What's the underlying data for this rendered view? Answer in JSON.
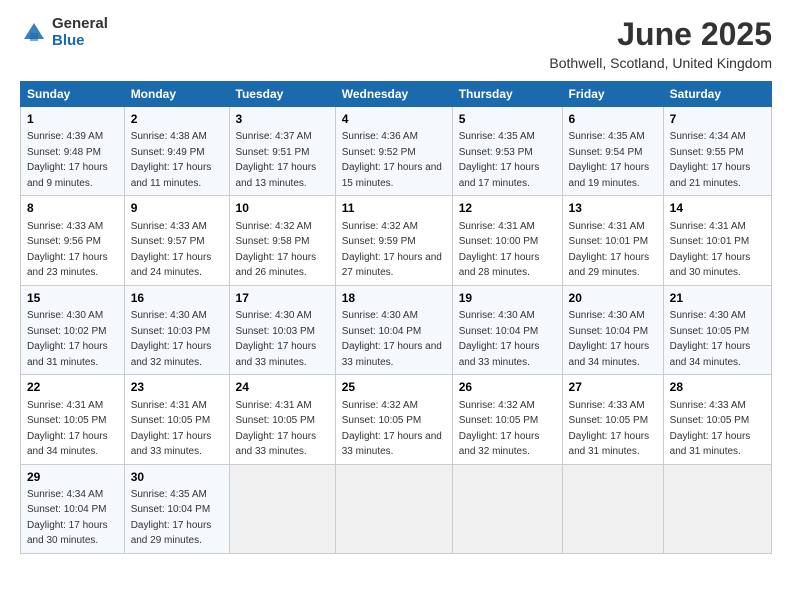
{
  "logo": {
    "general": "General",
    "blue": "Blue"
  },
  "title": "June 2025",
  "subtitle": "Bothwell, Scotland, United Kingdom",
  "headers": [
    "Sunday",
    "Monday",
    "Tuesday",
    "Wednesday",
    "Thursday",
    "Friday",
    "Saturday"
  ],
  "weeks": [
    [
      {
        "day": "1",
        "sunrise": "4:39 AM",
        "sunset": "9:48 PM",
        "daylight": "17 hours and 9 minutes."
      },
      {
        "day": "2",
        "sunrise": "4:38 AM",
        "sunset": "9:49 PM",
        "daylight": "17 hours and 11 minutes."
      },
      {
        "day": "3",
        "sunrise": "4:37 AM",
        "sunset": "9:51 PM",
        "daylight": "17 hours and 13 minutes."
      },
      {
        "day": "4",
        "sunrise": "4:36 AM",
        "sunset": "9:52 PM",
        "daylight": "17 hours and 15 minutes."
      },
      {
        "day": "5",
        "sunrise": "4:35 AM",
        "sunset": "9:53 PM",
        "daylight": "17 hours and 17 minutes."
      },
      {
        "day": "6",
        "sunrise": "4:35 AM",
        "sunset": "9:54 PM",
        "daylight": "17 hours and 19 minutes."
      },
      {
        "day": "7",
        "sunrise": "4:34 AM",
        "sunset": "9:55 PM",
        "daylight": "17 hours and 21 minutes."
      }
    ],
    [
      {
        "day": "8",
        "sunrise": "4:33 AM",
        "sunset": "9:56 PM",
        "daylight": "17 hours and 23 minutes."
      },
      {
        "day": "9",
        "sunrise": "4:33 AM",
        "sunset": "9:57 PM",
        "daylight": "17 hours and 24 minutes."
      },
      {
        "day": "10",
        "sunrise": "4:32 AM",
        "sunset": "9:58 PM",
        "daylight": "17 hours and 26 minutes."
      },
      {
        "day": "11",
        "sunrise": "4:32 AM",
        "sunset": "9:59 PM",
        "daylight": "17 hours and 27 minutes."
      },
      {
        "day": "12",
        "sunrise": "4:31 AM",
        "sunset": "10:00 PM",
        "daylight": "17 hours and 28 minutes."
      },
      {
        "day": "13",
        "sunrise": "4:31 AM",
        "sunset": "10:01 PM",
        "daylight": "17 hours and 29 minutes."
      },
      {
        "day": "14",
        "sunrise": "4:31 AM",
        "sunset": "10:01 PM",
        "daylight": "17 hours and 30 minutes."
      }
    ],
    [
      {
        "day": "15",
        "sunrise": "4:30 AM",
        "sunset": "10:02 PM",
        "daylight": "17 hours and 31 minutes."
      },
      {
        "day": "16",
        "sunrise": "4:30 AM",
        "sunset": "10:03 PM",
        "daylight": "17 hours and 32 minutes."
      },
      {
        "day": "17",
        "sunrise": "4:30 AM",
        "sunset": "10:03 PM",
        "daylight": "17 hours and 33 minutes."
      },
      {
        "day": "18",
        "sunrise": "4:30 AM",
        "sunset": "10:04 PM",
        "daylight": "17 hours and 33 minutes."
      },
      {
        "day": "19",
        "sunrise": "4:30 AM",
        "sunset": "10:04 PM",
        "daylight": "17 hours and 33 minutes."
      },
      {
        "day": "20",
        "sunrise": "4:30 AM",
        "sunset": "10:04 PM",
        "daylight": "17 hours and 34 minutes."
      },
      {
        "day": "21",
        "sunrise": "4:30 AM",
        "sunset": "10:05 PM",
        "daylight": "17 hours and 34 minutes."
      }
    ],
    [
      {
        "day": "22",
        "sunrise": "4:31 AM",
        "sunset": "10:05 PM",
        "daylight": "17 hours and 34 minutes."
      },
      {
        "day": "23",
        "sunrise": "4:31 AM",
        "sunset": "10:05 PM",
        "daylight": "17 hours and 33 minutes."
      },
      {
        "day": "24",
        "sunrise": "4:31 AM",
        "sunset": "10:05 PM",
        "daylight": "17 hours and 33 minutes."
      },
      {
        "day": "25",
        "sunrise": "4:32 AM",
        "sunset": "10:05 PM",
        "daylight": "17 hours and 33 minutes."
      },
      {
        "day": "26",
        "sunrise": "4:32 AM",
        "sunset": "10:05 PM",
        "daylight": "17 hours and 32 minutes."
      },
      {
        "day": "27",
        "sunrise": "4:33 AM",
        "sunset": "10:05 PM",
        "daylight": "17 hours and 31 minutes."
      },
      {
        "day": "28",
        "sunrise": "4:33 AM",
        "sunset": "10:05 PM",
        "daylight": "17 hours and 31 minutes."
      }
    ],
    [
      {
        "day": "29",
        "sunrise": "4:34 AM",
        "sunset": "10:04 PM",
        "daylight": "17 hours and 30 minutes."
      },
      {
        "day": "30",
        "sunrise": "4:35 AM",
        "sunset": "10:04 PM",
        "daylight": "17 hours and 29 minutes."
      },
      null,
      null,
      null,
      null,
      null
    ]
  ]
}
